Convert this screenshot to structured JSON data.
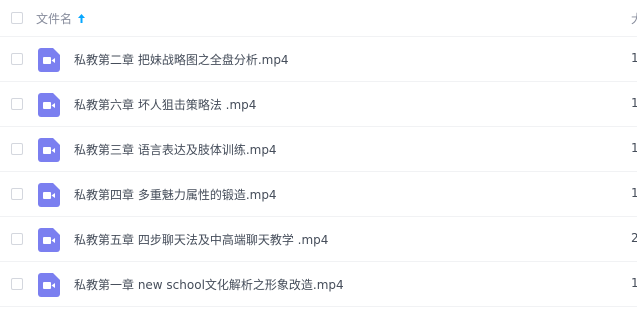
{
  "header": {
    "name_column": "文件名",
    "second_column": "大"
  },
  "icon_color": "#7b7ff0",
  "files": [
    {
      "name": "私教第二章 把妹战略图之全盘分析.mp4",
      "col2": "1"
    },
    {
      "name": "私教第六章 坏人狙击策略法 .mp4",
      "col2": "1"
    },
    {
      "name": "私教第三章 语言表达及肢体训练.mp4",
      "col2": "1"
    },
    {
      "name": "私教第四章 多重魅力属性的锻造.mp4",
      "col2": "1"
    },
    {
      "name": "私教第五章 四步聊天法及中高端聊天教学 .mp4",
      "col2": "2"
    },
    {
      "name": "私教第一章 new school文化解析之形象改造.mp4",
      "col2": "1"
    }
  ]
}
